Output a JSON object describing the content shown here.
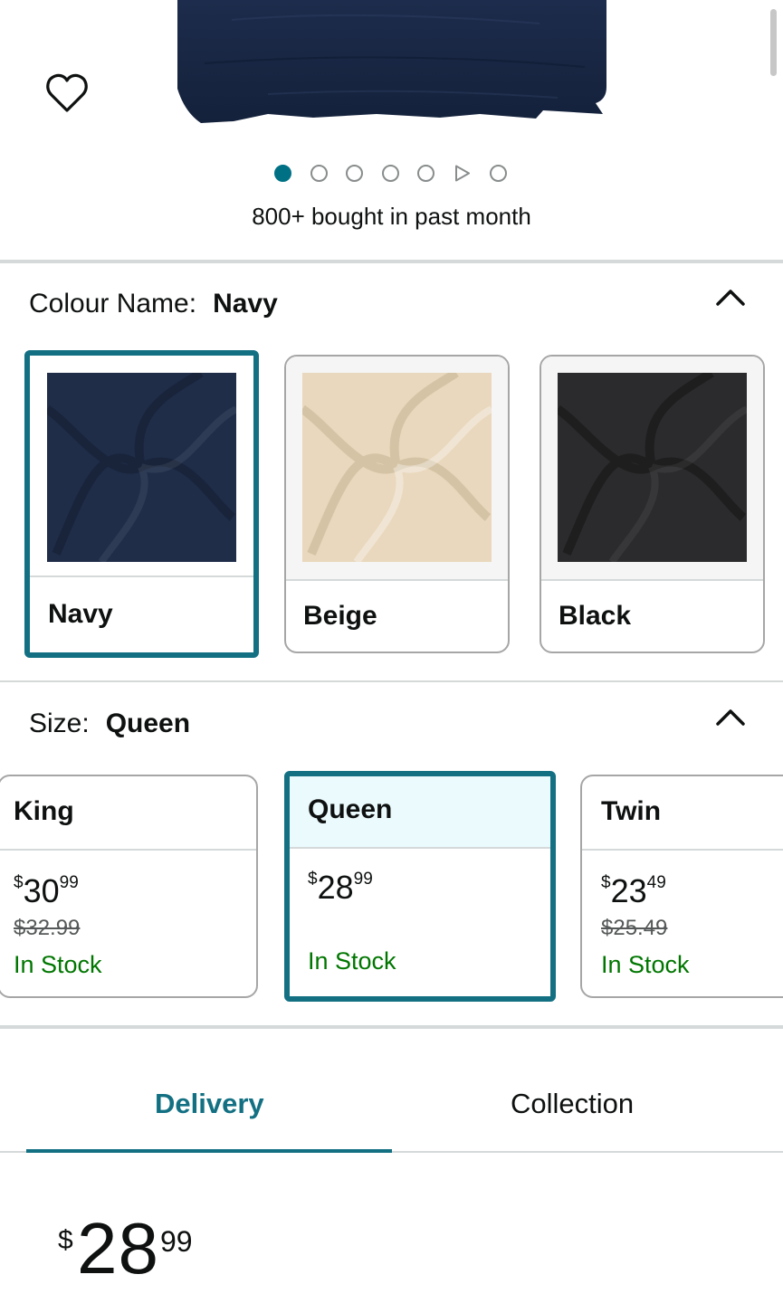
{
  "hero": {
    "image": "navy-sheet-product-photo",
    "carousel": {
      "count": 7,
      "active_index": 0,
      "video_index": 5
    },
    "bought_text": "800+ bought in past month"
  },
  "colour": {
    "label": "Colour Name:",
    "selected": "Navy",
    "options": [
      {
        "label": "Navy",
        "color": "#1f2d49"
      },
      {
        "label": "Beige",
        "color": "#e9d8bd"
      },
      {
        "label": "Black",
        "color": "#2b2b2d"
      }
    ]
  },
  "size": {
    "label": "Size:",
    "selected": "Queen",
    "options": [
      {
        "label": "King",
        "currency": "$",
        "whole": "30",
        "fraction": "99",
        "was": "$32.99",
        "stock": "In Stock"
      },
      {
        "label": "Queen",
        "currency": "$",
        "whole": "28",
        "fraction": "99",
        "was": "",
        "stock": "In Stock"
      },
      {
        "label": "Twin",
        "currency": "$",
        "whole": "23",
        "fraction": "49",
        "was": "$25.49",
        "stock": "In Stock"
      }
    ]
  },
  "tabs": {
    "delivery": "Delivery",
    "collection": "Collection",
    "active": "Delivery"
  },
  "price": {
    "currency": "$",
    "whole": "28",
    "fraction": "99"
  },
  "colors": {
    "accent": "#137083",
    "in_stock": "#007600",
    "selected_bg": "#eafafd"
  }
}
